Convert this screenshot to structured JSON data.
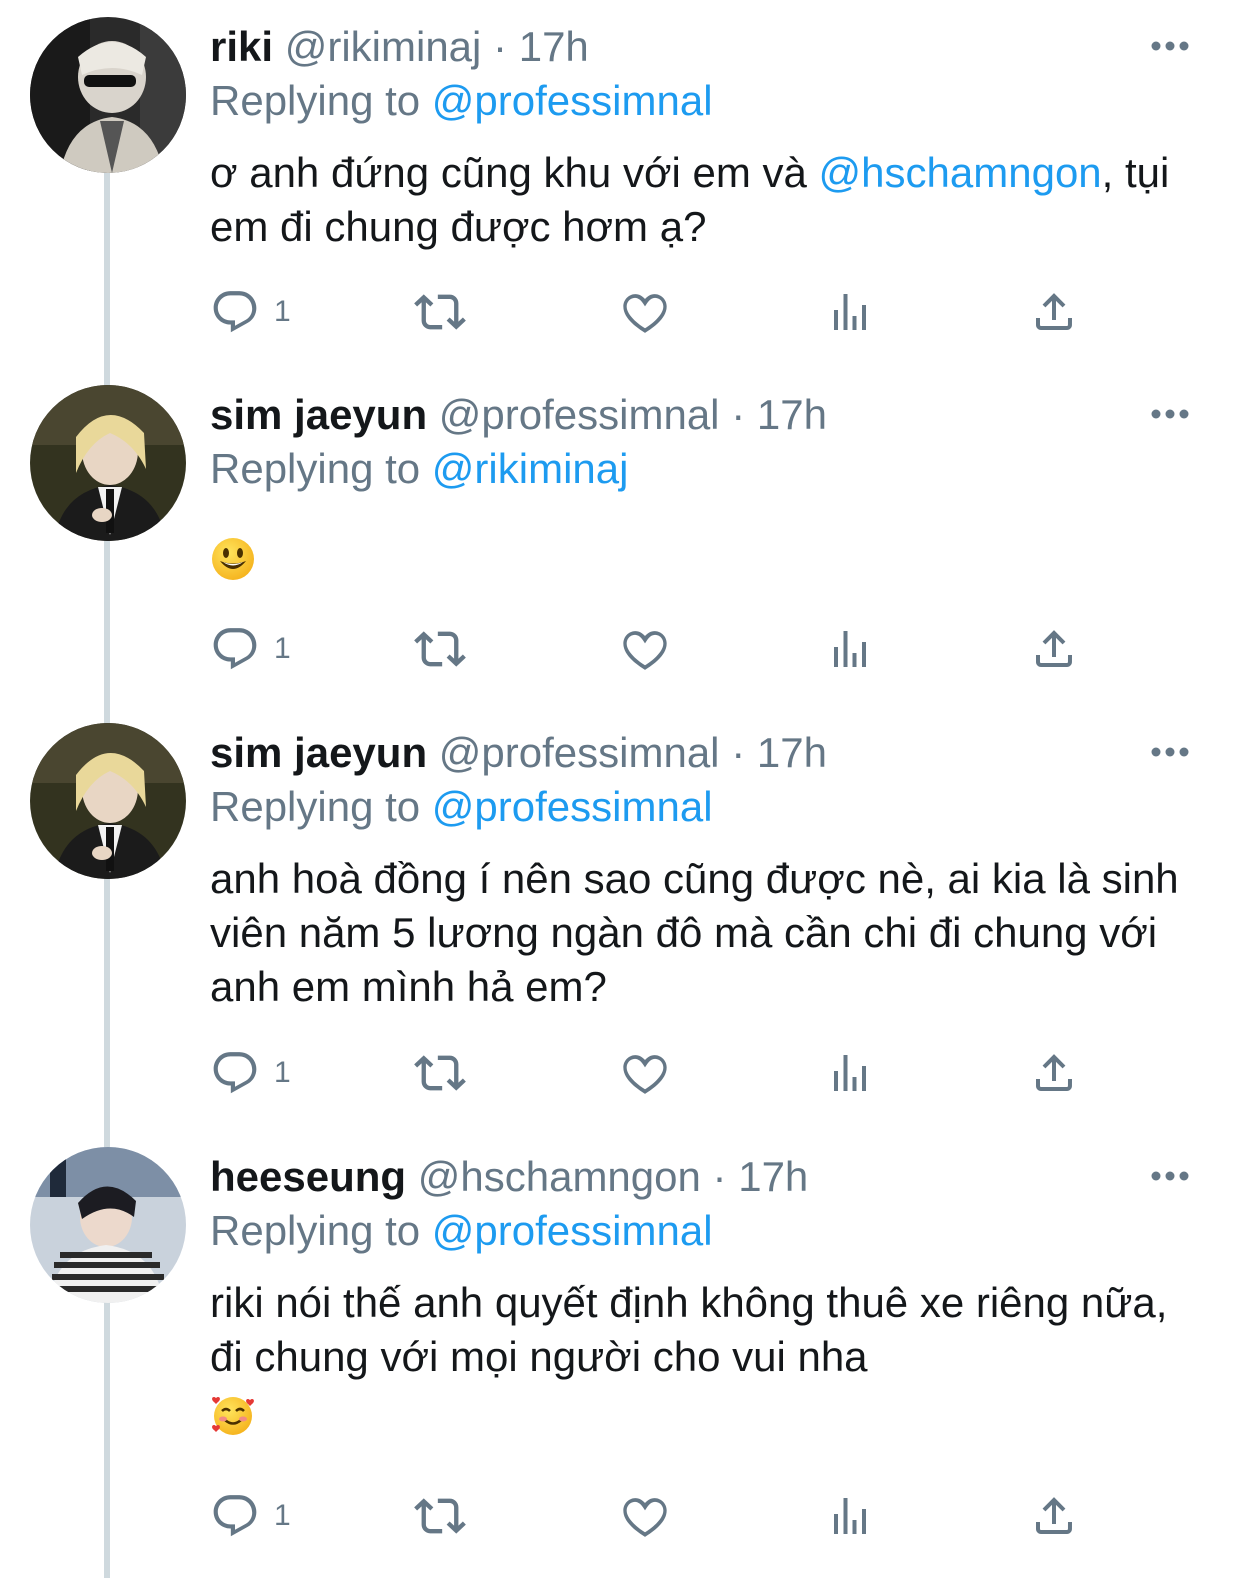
{
  "colors": {
    "link": "#1d9bf0",
    "secondary_text": "#657786",
    "primary_text": "#14171a",
    "thread_line": "#cfd9de"
  },
  "tweets": [
    {
      "name": "riki",
      "handle": "@rikiminaj",
      "separator": "·",
      "time": "17h",
      "replying_prefix": "Replying to",
      "replying_to": "@professimnal",
      "text_parts": [
        "ơ anh đứng cũng khu với em và ",
        "@hschamngon",
        ", tụi em đi chung được hơm ạ?"
      ],
      "reply_count": "1"
    },
    {
      "name": "sim jaeyun",
      "handle": "@professimnal",
      "separator": "·",
      "time": "17h",
      "replying_prefix": "Replying to",
      "replying_to": "@rikiminaj",
      "emoji": "smiling-face-emoji",
      "reply_count": "1"
    },
    {
      "name": "sim jaeyun",
      "handle": "@professimnal",
      "separator": "·",
      "time": "17h",
      "replying_prefix": "Replying to",
      "replying_to": "@professimnal",
      "text": "anh hoà đồng í nên sao cũng được nè, ai kia là sinh viên năm 5 lương ngàn đô mà cần chi đi chung với anh em mình hả em?",
      "reply_count": "1"
    },
    {
      "name": "heeseung",
      "handle": "@hschamngon",
      "separator": "·",
      "time": "17h",
      "replying_prefix": "Replying to",
      "replying_to": "@professimnal",
      "text": "riki nói thế anh quyết định không thuê xe riêng nữa, đi chung với mọi người cho vui nha",
      "emoji": "smiling-face-with-hearts-emoji",
      "reply_count": "1"
    }
  ],
  "icons": {
    "reply": "reply-icon",
    "retweet": "retweet-icon",
    "like": "heart-icon",
    "views": "analytics-icon",
    "share": "share-icon",
    "more": "more-icon"
  }
}
